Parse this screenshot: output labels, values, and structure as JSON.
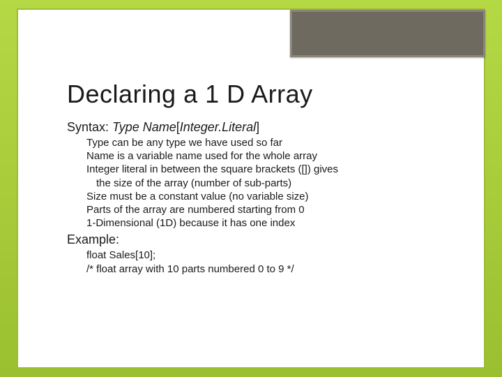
{
  "title": "Declaring a 1 D Array",
  "syntax": {
    "prefix": "Syntax: ",
    "type": "Type",
    "name": " Name",
    "lb": "[",
    "intlit": "Integer.Literal",
    "rb": "]"
  },
  "bullets": {
    "b1": "Type can be any type we have used so far",
    "b2": "Name is a variable name used for the whole array",
    "b3": "Integer literal in between the square brackets ([]) gives",
    "b3b": "the size of the array (number of sub-parts)",
    "b4": "Size must be a constant value (no variable size)",
    "b5": "Parts of the array are numbered starting from 0",
    "b6": "1-Dimensional (1D) because it has one index"
  },
  "example": {
    "label": "Example:",
    "e1": "float Sales[10];",
    "e2": "/* float array with 10 parts numbered 0 to 9 */"
  }
}
